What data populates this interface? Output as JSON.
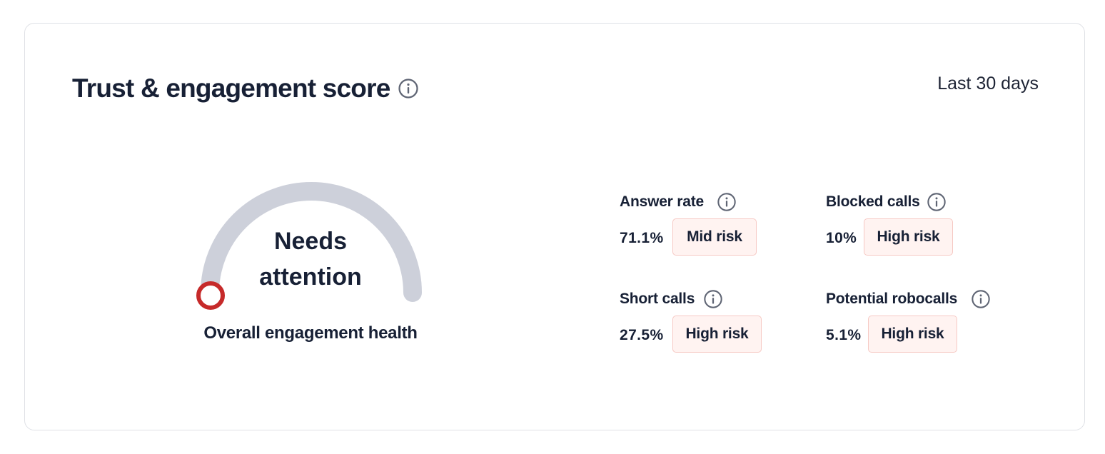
{
  "header": {
    "title": "Trust & engagement score",
    "period": "Last 30 days",
    "info_icon": "info-icon"
  },
  "gauge": {
    "status_line1": "Needs",
    "status_line2": "attention",
    "caption": "Overall engagement health",
    "indicator_level": 0,
    "track_color": "#cdd0da",
    "indicator_color": "#c62a2a"
  },
  "metrics": [
    {
      "label": "Answer rate",
      "value": "71.1%",
      "risk": "Mid risk"
    },
    {
      "label": "Blocked calls",
      "value": "10%",
      "risk": "High risk"
    },
    {
      "label": "Short calls",
      "value": "27.5%",
      "risk": "High risk"
    },
    {
      "label": "Potential robocalls",
      "value": "5.1%",
      "risk": "High risk"
    }
  ],
  "colors": {
    "text": "#172035",
    "badge_bg": "#fff3f1",
    "badge_border": "#f6c9c4",
    "icon": "#5f6574"
  }
}
